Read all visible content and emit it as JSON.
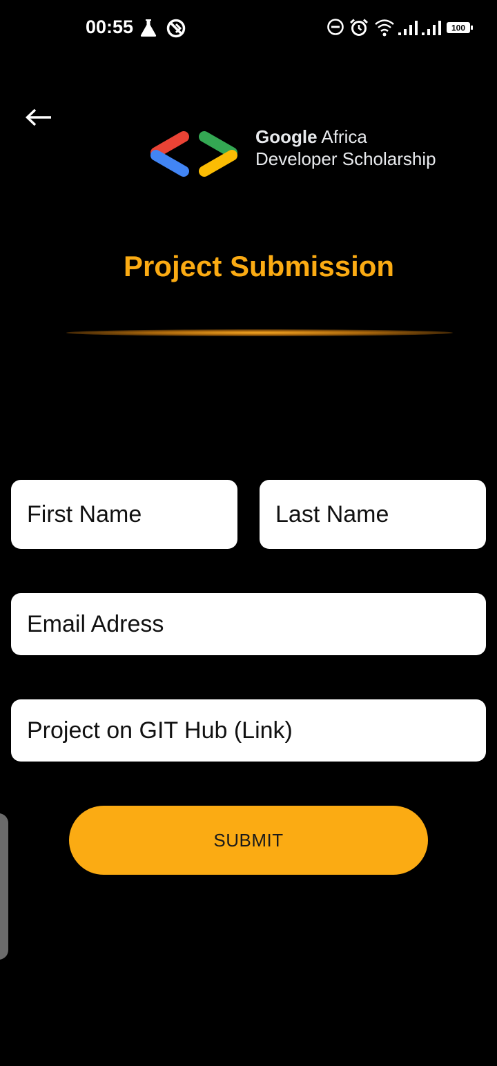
{
  "status_bar": {
    "time": "00:55",
    "battery": "100",
    "icons": [
      "flask-icon",
      "data-saver-icon",
      "dnd-icon",
      "alarm-icon",
      "wifi-icon",
      "signal-icon",
      "signal-icon-2",
      "battery-icon"
    ]
  },
  "header": {
    "back_icon": "arrow-left-icon",
    "logo": {
      "line1_bold": "Google",
      "line1_rest": " Africa",
      "line2": "Developer Scholarship"
    }
  },
  "main": {
    "title": "Project Submission",
    "form": {
      "first_name_placeholder": "First Name",
      "last_name_placeholder": "Last Name",
      "email_placeholder": "Email Adress",
      "github_placeholder": "Project on GIT Hub (Link)",
      "submit_label": "SUBMIT"
    }
  },
  "colors": {
    "accent": "#fbab13",
    "background": "#000000",
    "field_bg": "#ffffff",
    "logo_red": "#ea4335",
    "logo_blue": "#4285f4",
    "logo_green": "#34a853",
    "logo_yellow": "#fbbc04"
  }
}
